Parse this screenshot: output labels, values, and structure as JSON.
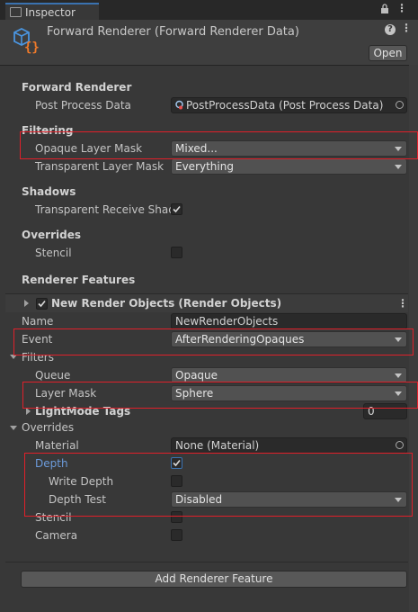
{
  "tab": {
    "label": "Inspector"
  },
  "header": {
    "title": "Forward Renderer (Forward Renderer Data)",
    "open_label": "Open"
  },
  "sections": {
    "forward_renderer": "Forward Renderer",
    "filtering": "Filtering",
    "shadows": "Shadows",
    "overrides": "Overrides",
    "renderer_features": "Renderer Features"
  },
  "fields": {
    "post_process_label": "Post Process Data",
    "post_process_value": "PostProcessData (Post Process Data)",
    "opaque_mask_label": "Opaque Layer Mask",
    "opaque_mask_value": "Mixed...",
    "transparent_mask_label": "Transparent Layer Mask",
    "transparent_mask_value": "Everything",
    "transparent_shadows_label": "Transparent Receive Shad",
    "stencil_label": "Stencil"
  },
  "feature": {
    "title": "New Render Objects (Render Objects)",
    "name_label": "Name",
    "name_value": "NewRenderObjects",
    "event_label": "Event",
    "event_value": "AfterRenderingOpaques",
    "filters_label": "Filters",
    "queue_label": "Queue",
    "queue_value": "Opaque",
    "layer_mask_label": "Layer Mask",
    "layer_mask_value": "Sphere",
    "lightmode_label": "LightMode Tags",
    "lightmode_value": "0",
    "overrides_label": "Overrides",
    "material_label": "Material",
    "material_value": "None (Material)",
    "depth_label": "Depth",
    "write_depth_label": "Write Depth",
    "depth_test_label": "Depth Test",
    "depth_test_value": "Disabled",
    "stencil_label": "Stencil",
    "camera_label": "Camera"
  },
  "add_feature_label": "Add Renderer Feature",
  "colors": {
    "highlight": "#e0202a",
    "link_blue": "#6c9bdb",
    "accent": "#3a72b0"
  }
}
